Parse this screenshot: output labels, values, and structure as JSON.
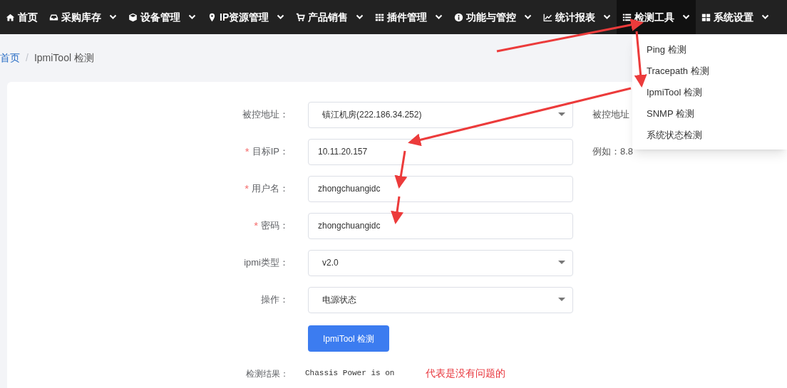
{
  "nav": {
    "items": [
      {
        "label": "首页",
        "kind": "home",
        "dropdown": false,
        "selected": false
      },
      {
        "label": "采购库存",
        "kind": "inbox",
        "dropdown": true,
        "selected": false
      },
      {
        "label": "设备管理",
        "kind": "cube",
        "dropdown": true,
        "selected": false
      },
      {
        "label": "IP资源管理",
        "kind": "pin",
        "dropdown": true,
        "selected": false
      },
      {
        "label": "产品销售",
        "kind": "cart",
        "dropdown": true,
        "selected": false
      },
      {
        "label": "插件管理",
        "kind": "grid",
        "dropdown": true,
        "selected": false
      },
      {
        "label": "功能与管控",
        "kind": "info",
        "dropdown": true,
        "selected": false
      },
      {
        "label": "统计报表",
        "kind": "chart",
        "dropdown": true,
        "selected": false
      },
      {
        "label": "检测工具",
        "kind": "list",
        "dropdown": true,
        "selected": true
      },
      {
        "label": "系统设置",
        "kind": "tiles",
        "dropdown": true,
        "selected": false
      }
    ]
  },
  "breadcrumb": {
    "separator": "/",
    "items": [
      {
        "label": "首页",
        "kind": "link"
      },
      {
        "label": "IpmiTool 检测",
        "kind": "current"
      }
    ]
  },
  "dropdown_menu": {
    "items": [
      {
        "label": "Ping 检测"
      },
      {
        "label": "Tracepath 检测"
      },
      {
        "label": "IpmiTool 检测"
      },
      {
        "label": "SNMP 检测"
      },
      {
        "label": "系统状态检测"
      }
    ]
  },
  "form": {
    "fields": [
      {
        "label": "被控地址：",
        "kind": "select",
        "value": "镇江机房(222.186.34.252)"
      },
      {
        "required_mark": "*",
        "label": "目标IP：",
        "kind": "input",
        "value": "10.11.20.157"
      },
      {
        "required_mark": "*",
        "label": "用户名：",
        "kind": "input",
        "value": "zhongchuangidc"
      },
      {
        "required_mark": "*",
        "label": "密码：",
        "kind": "input",
        "value": "zhongchuangidc"
      },
      {
        "label": "ipmi类型：",
        "kind": "select",
        "value": "v2.0"
      },
      {
        "label": "操作：",
        "kind": "select",
        "value": "电源状态"
      }
    ],
    "help_texts": [
      "被控地址",
      "例如：8.8"
    ],
    "submit_button": "IpmiTool 检测",
    "result": {
      "label": "检测结果：",
      "value": "Chassis Power is on"
    }
  },
  "annotation": "代表是没有问题的"
}
